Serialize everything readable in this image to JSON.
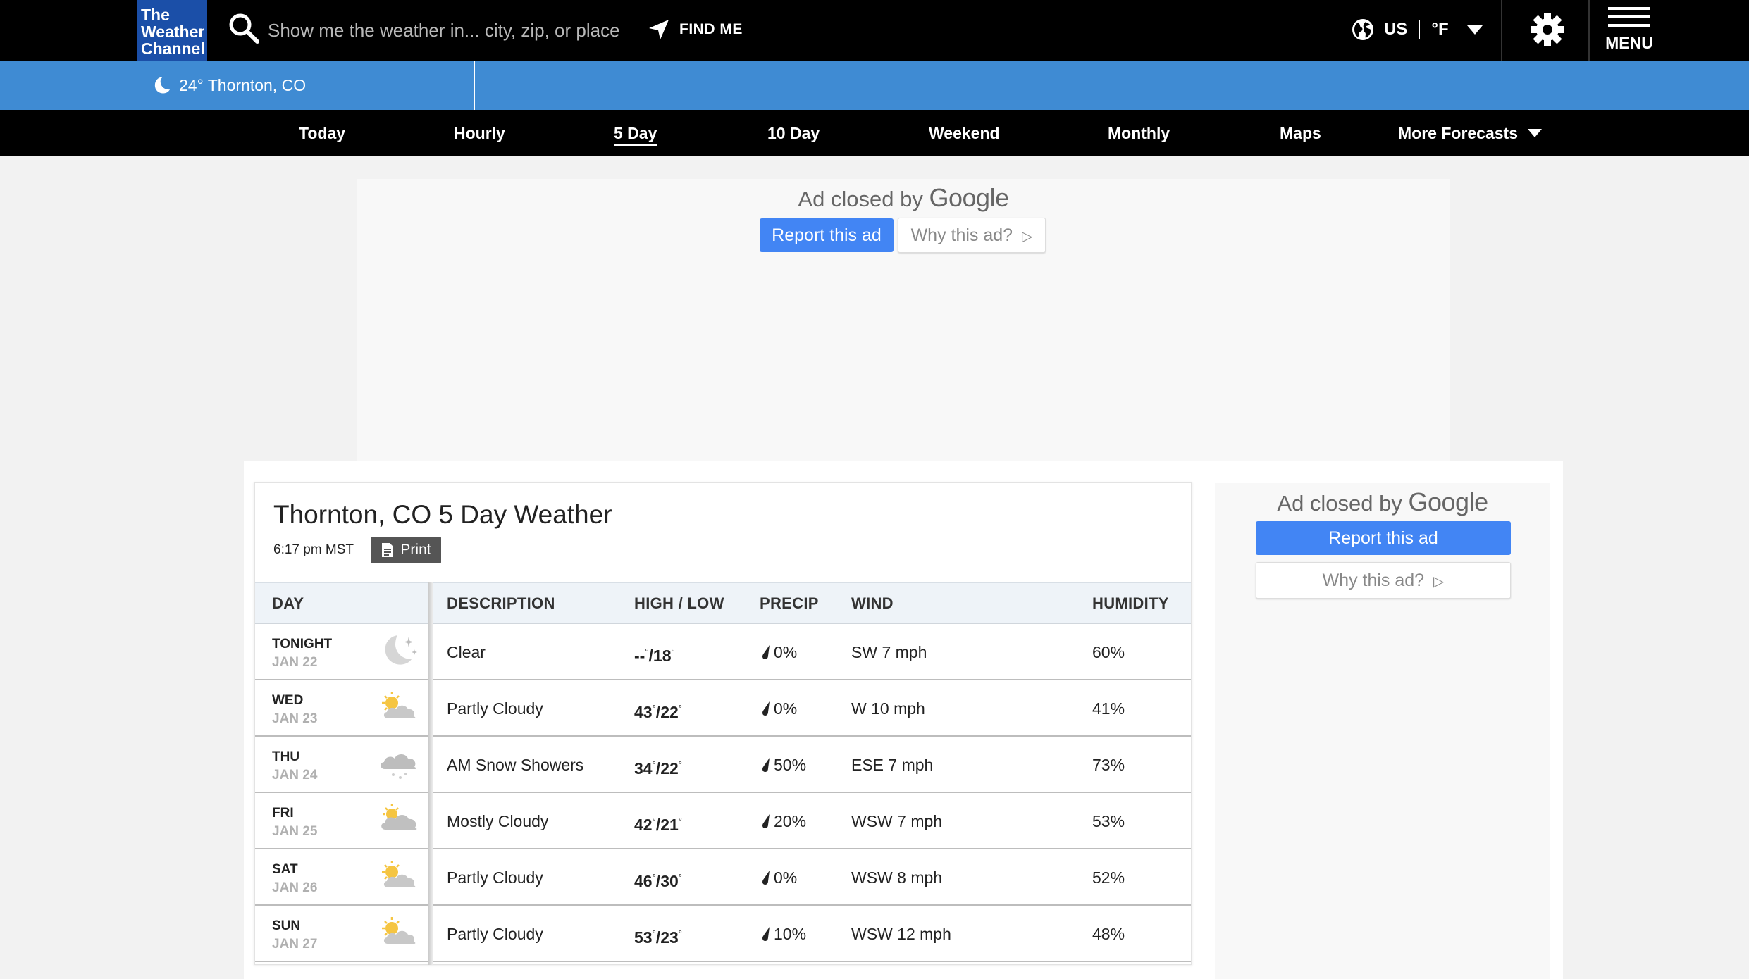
{
  "header": {
    "logo_lines": [
      "The",
      "Weather",
      "Channel"
    ],
    "search_placeholder": "Show me the weather in... city, zip, or place",
    "find_me": "FIND ME",
    "region": "US",
    "unit": "°F",
    "menu": "MENU",
    "icons": {
      "search": "search-icon",
      "find_me": "location-arrow-icon",
      "globe": "globe-icon",
      "settings": "gear-icon",
      "menu": "hamburger-icon"
    }
  },
  "location_bar": {
    "current": "24° Thornton, CO",
    "icon": "moon-icon"
  },
  "nav": {
    "items": [
      {
        "label": "Today"
      },
      {
        "label": "Hourly"
      },
      {
        "label": "5 Day"
      },
      {
        "label": "10 Day"
      },
      {
        "label": "Weekend"
      },
      {
        "label": "Monthly"
      },
      {
        "label": "Maps"
      },
      {
        "label": "More Forecasts"
      }
    ],
    "active": "5 Day"
  },
  "ads": {
    "closed_prefix": "Ad closed by",
    "closed_brand": "Google",
    "report": "Report this ad",
    "why": "Why this ad?"
  },
  "forecast": {
    "title": "Thornton, CO 5 Day Weather",
    "time": "6:17 pm MST",
    "print": "Print",
    "columns": [
      "DAY",
      "DESCRIPTION",
      "HIGH / LOW",
      "PRECIP",
      "WIND",
      "HUMIDITY"
    ],
    "rows": [
      {
        "day": "TONIGHT",
        "date": "JAN 22",
        "icon": "clear-night-icon",
        "desc": "Clear",
        "high": "--",
        "low": "18",
        "precip": "0%",
        "wind": "SW 7 mph",
        "humidity": "60%"
      },
      {
        "day": "WED",
        "date": "JAN 23",
        "icon": "partly-cloudy-icon",
        "desc": "Partly Cloudy",
        "high": "43",
        "low": "22",
        "precip": "0%",
        "wind": "W 10 mph",
        "humidity": "41%"
      },
      {
        "day": "THU",
        "date": "JAN 24",
        "icon": "snow-showers-icon",
        "desc": "AM Snow Showers",
        "high": "34",
        "low": "22",
        "precip": "50%",
        "wind": "ESE 7 mph",
        "humidity": "73%"
      },
      {
        "day": "FRI",
        "date": "JAN 25",
        "icon": "mostly-cloudy-icon",
        "desc": "Mostly Cloudy",
        "high": "42",
        "low": "21",
        "precip": "20%",
        "wind": "WSW 7 mph",
        "humidity": "53%"
      },
      {
        "day": "SAT",
        "date": "JAN 26",
        "icon": "partly-cloudy-icon",
        "desc": "Partly Cloudy",
        "high": "46",
        "low": "30",
        "precip": "0%",
        "wind": "WSW 8 mph",
        "humidity": "52%"
      },
      {
        "day": "SUN",
        "date": "JAN 27",
        "icon": "partly-cloudy-icon",
        "desc": "Partly Cloudy",
        "high": "53",
        "low": "23",
        "precip": "10%",
        "wind": "WSW 12 mph",
        "humidity": "48%"
      }
    ]
  },
  "colors": {
    "brand_blue": "#1b4fa8",
    "location_bar": "#3f8bd3",
    "ad_button": "#4285f4"
  }
}
